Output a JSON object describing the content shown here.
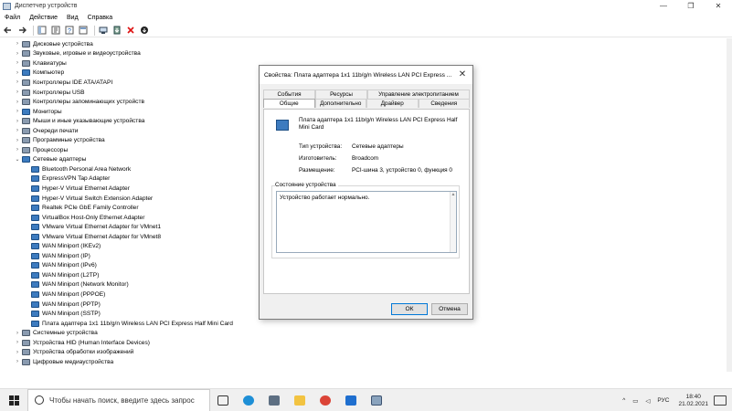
{
  "window": {
    "title": "Диспетчер устройств",
    "controls": [
      "—",
      "❐",
      "✕"
    ]
  },
  "menu": [
    "Файл",
    "Действие",
    "Вид",
    "Справка"
  ],
  "tree": {
    "categories_before": [
      "Дисковые устройства",
      "Звуковые, игровые и видеоустройства",
      "Клавиатуры",
      "Компьютер",
      "Контроллеры IDE ATA/ATAPI",
      "Контроллеры USB",
      "Контроллеры запоминающих устройств",
      "Мониторы",
      "Мыши и иные указывающие устройства",
      "Очереди печати",
      "Программные устройства",
      "Процессоры"
    ],
    "network": {
      "label": "Сетевые адаптеры",
      "children": [
        "Bluetooth Personal Area Network",
        "ExpressVPN Tap Adapter",
        "Hyper-V Virtual Ethernet Adapter",
        "Hyper-V Virtual Switch Extension Adapter",
        "Realtek PCIe GbE Family Controller",
        "VirtualBox Host-Only Ethernet Adapter",
        "VMware Virtual Ethernet Adapter for VMnet1",
        "VMware Virtual Ethernet Adapter for VMnet8",
        "WAN Miniport (IKEv2)",
        "WAN Miniport (IP)",
        "WAN Miniport (IPv6)",
        "WAN Miniport (L2TP)",
        "WAN Miniport (Network Monitor)",
        "WAN Miniport (PPPOE)",
        "WAN Miniport (PPTP)",
        "WAN Miniport (SSTP)",
        "Плата адаптера 1x1 11b/g/n Wireless LAN PCI Express Half Mini Card"
      ]
    },
    "categories_after": [
      "Системные устройства",
      "Устройства HID (Human Interface Devices)",
      "Устройства обработки изображений",
      "Цифровые медиаустройства"
    ]
  },
  "dialog": {
    "title": "Свойства: Плата адаптера 1x1 11b/g/n Wireless LAN PCI Express ...",
    "close": "✕",
    "tabs_row1": [
      "События",
      "Ресурсы",
      "Управление электропитанием"
    ],
    "tabs_row2": [
      "Общие",
      "Дополнительно",
      "Драйвер",
      "Сведения"
    ],
    "device_name": "Плата адаптера 1x1 11b/g/n Wireless LAN PCI Express Half Mini Card",
    "props": {
      "type_label": "Тип устройства:",
      "type_value": "Сетевые адаптеры",
      "maker_label": "Изготовитель:",
      "maker_value": "Broadcom",
      "location_label": "Размещение:",
      "location_value": "PCI-шина 3, устройство 0, функция 0"
    },
    "status_group": "Состояние устройства",
    "status_text": "Устройство работает нормально.",
    "ok": "ОК",
    "cancel": "Отмена"
  },
  "taskbar": {
    "search_placeholder": "Чтобы начать поиск, введите здесь запрос",
    "lang": "РУС",
    "time": "18:40",
    "date": "21.02.2021",
    "tray_arrow": "^"
  }
}
